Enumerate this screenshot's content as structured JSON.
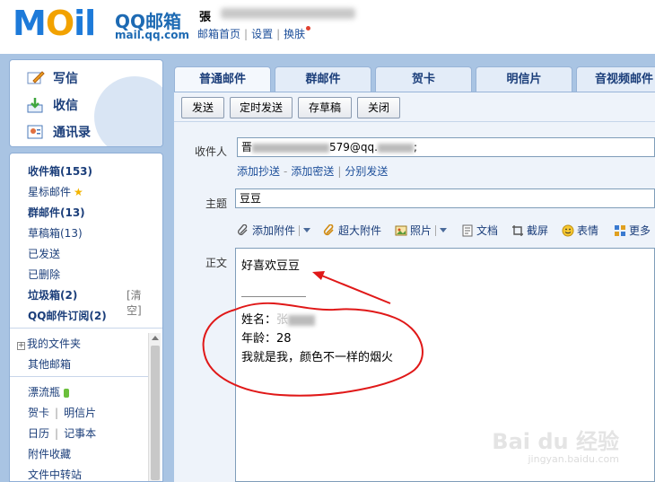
{
  "header": {
    "logo_main": "M",
    "logo_o": "O",
    "logo_rest": "il",
    "logo_cn": "QQ邮箱",
    "logo_domain": "mail.qq.com",
    "user_name": "張",
    "links": [
      "邮箱首页",
      "设置",
      "换肤"
    ]
  },
  "actions": [
    {
      "label": "写信",
      "icon": "write-icon"
    },
    {
      "label": "收信",
      "icon": "inbox-download-icon"
    },
    {
      "label": "通讯录",
      "icon": "contacts-icon"
    }
  ],
  "folders": {
    "inbox": "收件箱(153)",
    "starred": "星标邮件",
    "group": "群邮件(13)",
    "drafts": "草稿箱(13)",
    "sent": "已发送",
    "deleted": "已删除",
    "spam": "垃圾箱(2)",
    "spam_clear": "[清空]",
    "subscriptions": "QQ邮件订阅(2)",
    "my_folders": "我的文件夹",
    "other": "其他邮箱",
    "bottle": "漂流瓶",
    "cards": "贺卡",
    "postcards": "明信片",
    "calendar": "日历",
    "notes": "记事本",
    "attachments": "附件收藏",
    "transfer": "文件中转站"
  },
  "tabs": [
    "普通邮件",
    "群邮件",
    "贺卡",
    "明信片",
    "音视频邮件"
  ],
  "toolbar": {
    "send": "发送",
    "scheduled": "定时发送",
    "save_draft": "存草稿",
    "close": "关闭"
  },
  "compose": {
    "to_label": "收件人",
    "to_value_prefix": "晋",
    "to_value_suffix": "579@qq.",
    "to_trailing": ";",
    "add_cc": "添加抄送",
    "add_bcc": "添加密送",
    "separate_send": "分别发送",
    "subject_label": "主题",
    "subject_value": "豆豆",
    "body_label": "正文",
    "editor_tools": [
      "添加附件",
      "超大附件",
      "照片",
      "文档",
      "截屏",
      "表情",
      "更多"
    ],
    "body_lines": [
      "好喜欢豆豆",
      "姓名：",
      "年龄：28",
      "我就是我，颜色不一样的烟火"
    ],
    "name_initial": "张"
  },
  "watermark": {
    "text": "Bai du 经验",
    "sub": "jingyan.baidu.com"
  }
}
